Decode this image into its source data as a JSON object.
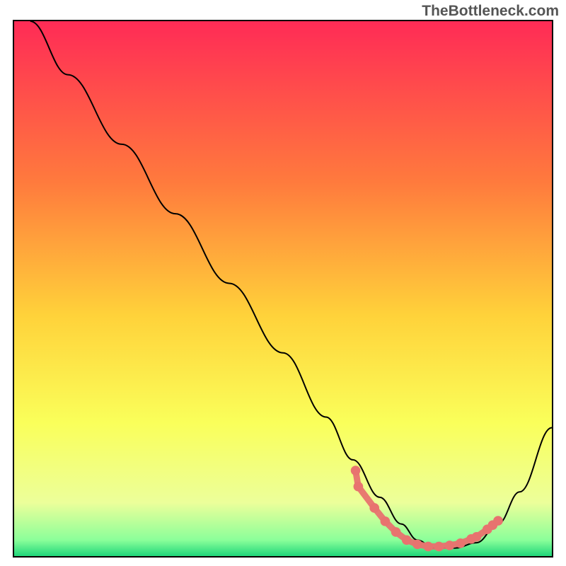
{
  "watermark": "TheBottleneck.com",
  "chart_data": {
    "type": "line",
    "title": "",
    "xlabel": "",
    "ylabel": "",
    "xlim": [
      0,
      100
    ],
    "ylim": [
      0,
      100
    ],
    "gradient_stops": [
      {
        "offset": 0,
        "color": "#ff2b56"
      },
      {
        "offset": 30,
        "color": "#ff7a3d"
      },
      {
        "offset": 55,
        "color": "#ffd23a"
      },
      {
        "offset": 75,
        "color": "#faff5a"
      },
      {
        "offset": 90,
        "color": "#ecff9a"
      },
      {
        "offset": 97,
        "color": "#8bff9a"
      },
      {
        "offset": 100,
        "color": "#1fd67a"
      }
    ],
    "series": [
      {
        "name": "bottleneck-curve",
        "color": "#000000",
        "x": [
          3,
          10,
          20,
          30,
          40,
          50,
          58,
          63,
          68,
          72,
          75,
          78,
          82,
          86,
          90,
          94,
          100
        ],
        "y": [
          100,
          90,
          77,
          64,
          51,
          38,
          26,
          18,
          11,
          6,
          3,
          1.5,
          1.5,
          2.5,
          6,
          12,
          24
        ]
      }
    ],
    "highlight_points": {
      "color": "#e8736f",
      "x": [
        63.5,
        64,
        67,
        69,
        71,
        73,
        75,
        77,
        79,
        81,
        83,
        85,
        86,
        88,
        89,
        90
      ],
      "y": [
        16,
        13,
        9,
        6.5,
        4.5,
        3,
        2.2,
        1.8,
        1.8,
        2,
        2.4,
        3.2,
        3.6,
        5,
        5.8,
        6.6
      ]
    }
  }
}
